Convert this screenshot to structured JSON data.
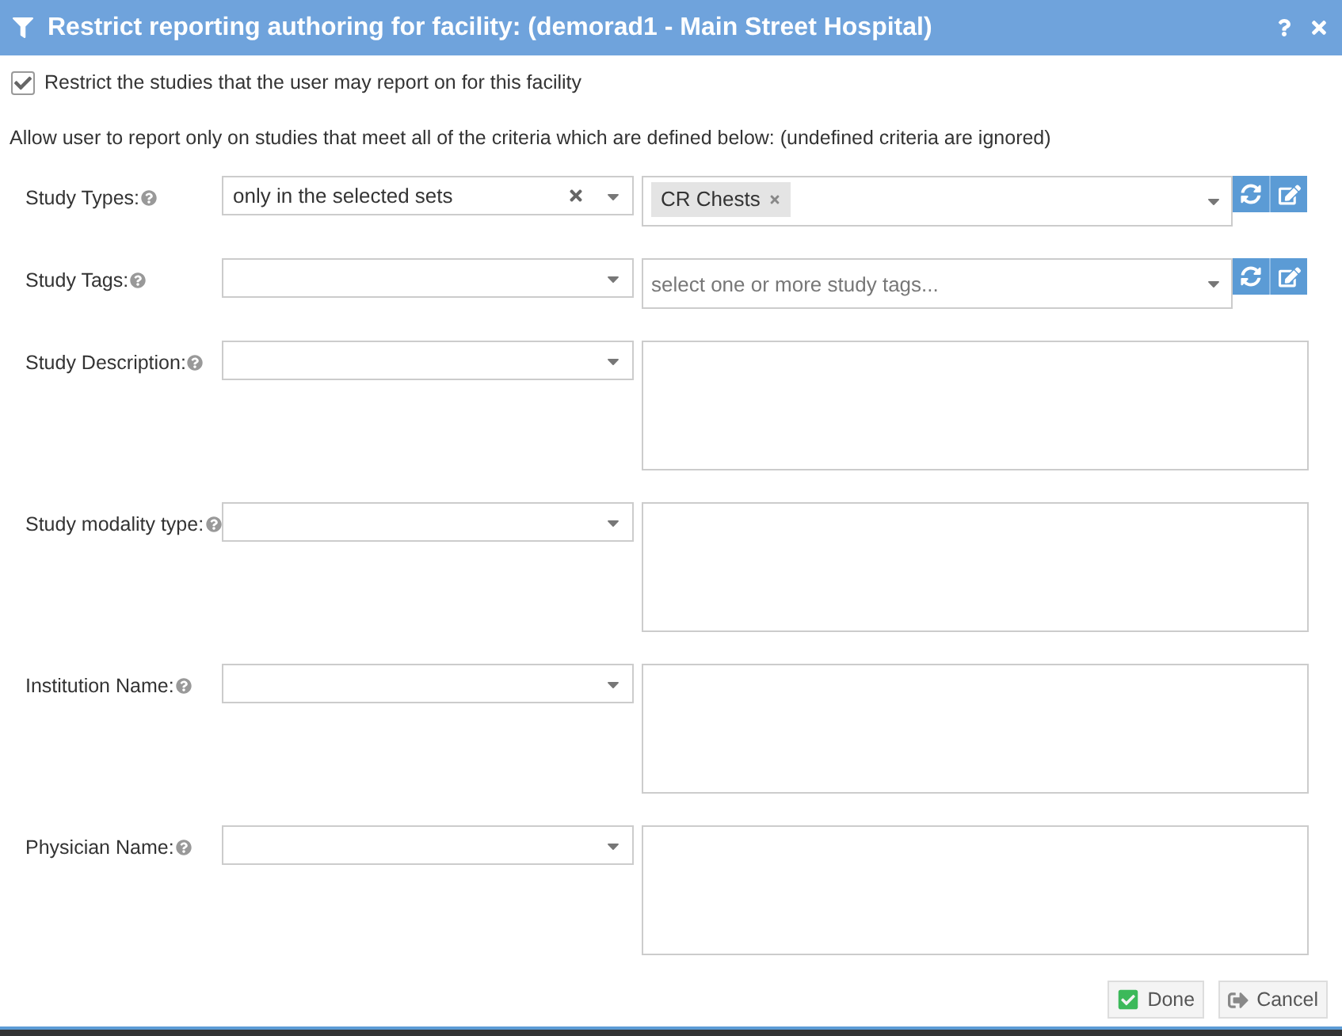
{
  "window": {
    "title": "Restrict reporting authoring for facility: (demorad1 - Main Street Hospital)"
  },
  "restrict": {
    "label": "Restrict the studies that the user may report on for this facility",
    "checked": true
  },
  "intro": "Allow user to report only on studies that meet all of the criteria which are defined below: (undefined criteria are ignored)",
  "criteria": [
    {
      "kind": "multiselect",
      "label": "Study Types:",
      "mode": "only in the selected sets",
      "tags": [
        "CR Chests"
      ]
    },
    {
      "kind": "multiselect",
      "label": "Study Tags:",
      "placeholder": "select one or more study tags..."
    },
    {
      "kind": "textarea",
      "label": "Study Description:"
    },
    {
      "kind": "textarea",
      "label": "Study modality type:"
    },
    {
      "kind": "textarea",
      "label": "Institution Name:"
    },
    {
      "kind": "textarea",
      "label": "Physician Name:"
    }
  ],
  "buttons": [
    {
      "kind": "done",
      "label": "Done"
    },
    {
      "kind": "cancel",
      "label": "Cancel"
    }
  ]
}
